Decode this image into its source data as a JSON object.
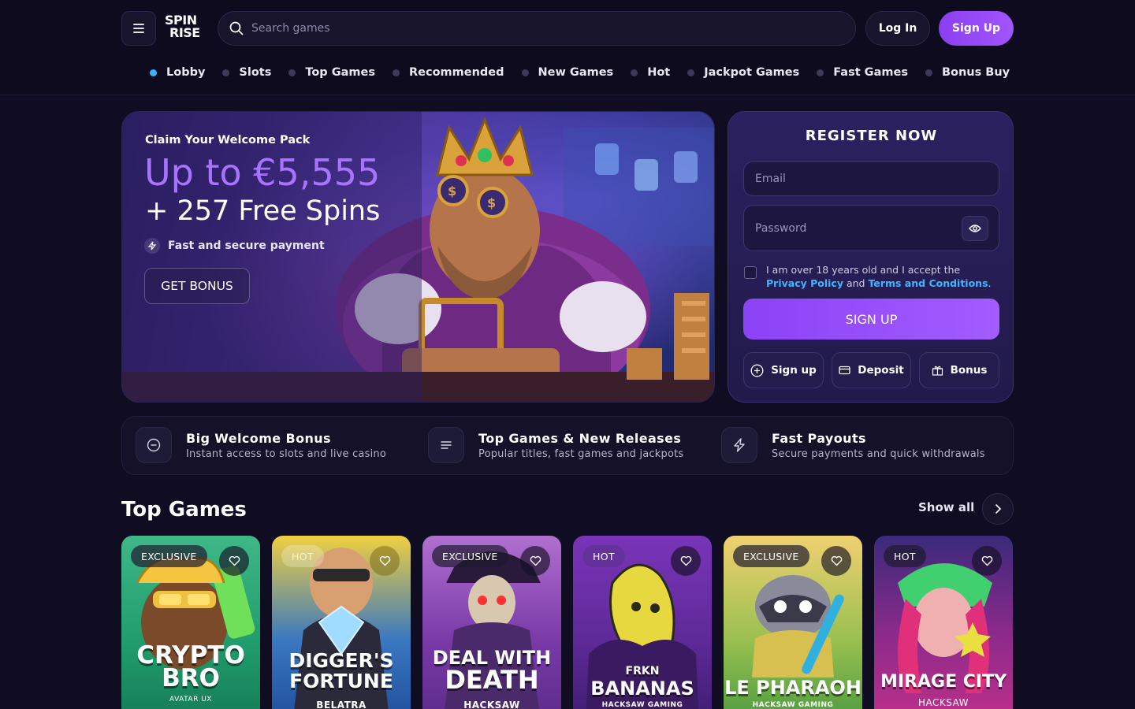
{
  "header": {
    "logo": {
      "line1": "SPIN",
      "line2": "RISE"
    },
    "search_placeholder": "Search games",
    "login_label": "Log In",
    "signup_label": "Sign Up"
  },
  "nav": {
    "items": [
      {
        "label": "Lobby",
        "active": true
      },
      {
        "label": "Slots"
      },
      {
        "label": "Top Games"
      },
      {
        "label": "Recommended"
      },
      {
        "label": "New Games"
      },
      {
        "label": "Hot"
      },
      {
        "label": "Jackpot Games"
      },
      {
        "label": "Fast Games"
      },
      {
        "label": "Bonus Buy"
      }
    ]
  },
  "hero": {
    "subtitle": "Claim Your Welcome Pack",
    "amount": "Up to €5,555",
    "spins": "+ 257 Free Spins",
    "secure_text": "Fast and secure payment",
    "cta": "GET BONUS"
  },
  "register": {
    "title": "REGISTER NOW",
    "email_placeholder": "Email",
    "password_placeholder": "Password",
    "consent_prefix": "I am over 18 years old and I accept the",
    "privacy_link": "Privacy Policy",
    "consent_and": "and",
    "terms_link": "Terms and Conditions",
    "consent_suffix": ".",
    "signup_button": "SIGN UP",
    "chips": [
      "Sign up",
      "Deposit",
      "Bonus"
    ]
  },
  "features": [
    {
      "title": "Big Welcome Bonus",
      "desc": "Instant access to slots and live casino",
      "icon": "minus-circle-icon"
    },
    {
      "title": "Top Games & New Releases",
      "desc": "Popular titles, fast games and jackpots",
      "icon": "list-icon"
    },
    {
      "title": "Fast Payouts",
      "desc": "Secure payments and quick withdrawals",
      "icon": "lightning-icon"
    }
  ],
  "top_games": {
    "title": "Top Games",
    "show_all": "Show all",
    "games": [
      {
        "badge": "EXCLUSIVE",
        "title_line1": "CRYPTO",
        "title_line2": "BRO",
        "provider": "AVATAR UX"
      },
      {
        "badge": "HOT",
        "title_line1": "DIGGER'S",
        "title_line2": "FORTUNE",
        "provider": "BELATRA"
      },
      {
        "badge": "EXCLUSIVE",
        "title_line1": "DEAL WITH",
        "title_line2": "DEATH",
        "provider": "HACKSAW"
      },
      {
        "badge": "HOT",
        "title_line1": "FRKN",
        "title_line2": "BANANAS",
        "provider": "HACKSAW GAMING"
      },
      {
        "badge": "EXCLUSIVE",
        "title_line1": "",
        "title_line2": "LE PHARAOH",
        "provider": "HACKSAW GAMING"
      },
      {
        "badge": "HOT",
        "title_line1": "",
        "title_line2": "MIRAGE CITY",
        "provider": "HACKSAW"
      }
    ]
  }
}
